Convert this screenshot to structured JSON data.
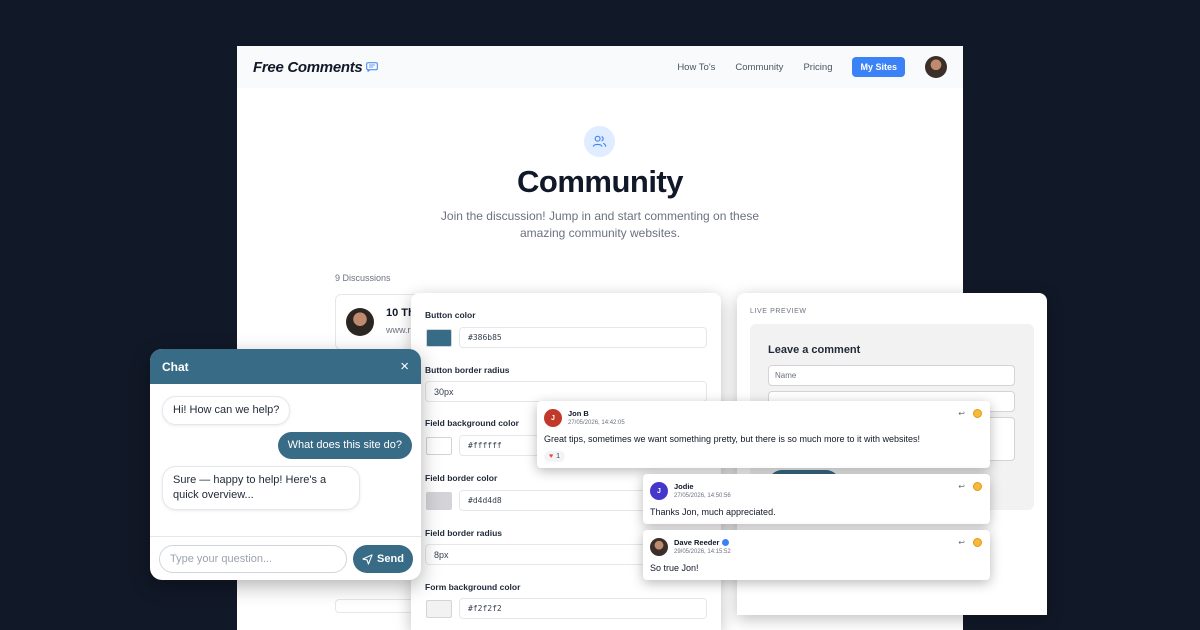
{
  "site": {
    "brand": "Free Comments",
    "nav": {
      "links": [
        "How To's",
        "Community",
        "Pricing"
      ],
      "cta": "My Sites"
    },
    "hero": {
      "title": "Community",
      "subtitle": "Join the discussion! Jump in and start commenting on these amazing community websites."
    },
    "discussions": {
      "count_label": "9 Discussions",
      "first": {
        "title": "10 Thi",
        "url": "www.r"
      }
    }
  },
  "settings": {
    "button_color": {
      "label": "Button color",
      "value": "#386b85",
      "swatch": "#386b85"
    },
    "button_border_radius": {
      "label": "Button border radius",
      "value": "30px"
    },
    "field_background_color": {
      "label": "Field background color",
      "value": "#ffffff",
      "swatch": "#ffffff"
    },
    "field_border_color": {
      "label": "Field border color",
      "value": "#d4d4d8",
      "swatch": "#d4d4d8"
    },
    "field_border_radius": {
      "label": "Field border radius",
      "value": "8px"
    },
    "form_background_color": {
      "label": "Form background color",
      "value": "#f2f2f2",
      "swatch": "#f2f2f2"
    }
  },
  "preview": {
    "label": "LIVE PREVIEW",
    "form_title": "Leave a comment",
    "name_placeholder": "Name"
  },
  "comments": [
    {
      "initial": "J",
      "name": "Jon B",
      "date": "27/05/2026, 14:42:05",
      "text": "Great tips, sometimes we want something pretty, but there is so much more to it with websites!",
      "reaction_count": "1",
      "avatar_color": "#c0392b"
    },
    {
      "initial": "J",
      "name": "Jodie",
      "date": "27/05/2026, 14:50:56",
      "text": "Thanks Jon, much appreciated.",
      "avatar_color": "#4338ca"
    },
    {
      "initial": "",
      "name": "Dave Reeder",
      "date": "29/05/2026, 14:15:52",
      "text": "So true Jon!",
      "avatar_color": "#3b2f2a"
    }
  ],
  "chat": {
    "title": "Chat",
    "close": "×",
    "messages": [
      {
        "from": "bot",
        "text": "Hi! How can we help?"
      },
      {
        "from": "user",
        "text": "What does this site do?"
      },
      {
        "from": "bot",
        "text": "Sure — happy to help! Here's a quick overview..."
      }
    ],
    "input_placeholder": "Type your question...",
    "send_label": "Send"
  },
  "colors": {
    "accent": "#386b85",
    "nav_button": "#3b82f6",
    "backdrop": "#111827"
  }
}
